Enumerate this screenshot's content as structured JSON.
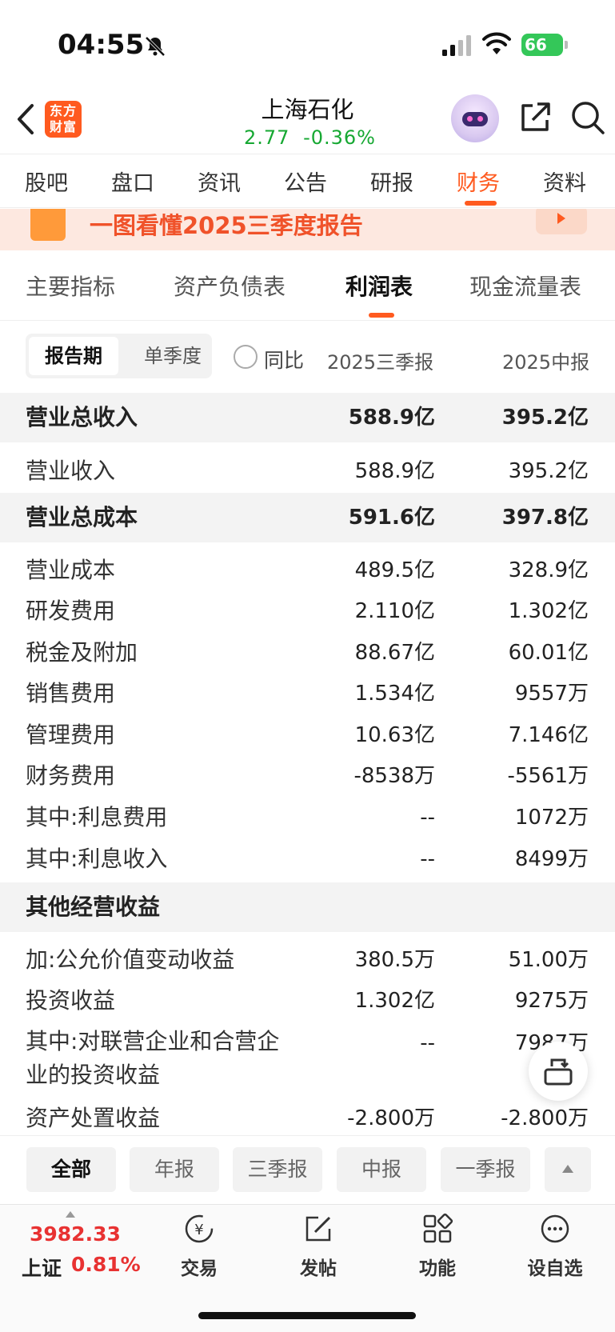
{
  "status": {
    "time": "04:55",
    "battery": "66"
  },
  "header": {
    "logo_text": "东方财富",
    "stock_name": "上海石化",
    "price": "2.77",
    "change": "-0.36%"
  },
  "top_tabs": [
    "股吧",
    "盘口",
    "资讯",
    "公告",
    "研报",
    "财务",
    "资料"
  ],
  "banner": {
    "text": "一图看懂2025三季度报告"
  },
  "sub_tabs": [
    "主要指标",
    "资产负债表",
    "利润表",
    "现金流量表"
  ],
  "filter": {
    "report_period": "报告期",
    "single_quarter": "单季度",
    "yoy": "同比",
    "col1": "2025三季报",
    "col2": "2025中报"
  },
  "rows": [
    {
      "label": "营业总收入",
      "v1": "588.9亿",
      "v2": "395.2亿",
      "section": true
    },
    {
      "label": "营业收入",
      "v1": "588.9亿",
      "v2": "395.2亿"
    },
    {
      "label": "营业总成本",
      "v1": "591.6亿",
      "v2": "397.8亿",
      "section": true
    },
    {
      "label": "营业成本",
      "v1": "489.5亿",
      "v2": "328.9亿"
    },
    {
      "label": "研发费用",
      "v1": "2.110亿",
      "v2": "1.302亿"
    },
    {
      "label": "税金及附加",
      "v1": "88.67亿",
      "v2": "60.01亿"
    },
    {
      "label": "销售费用",
      "v1": "1.534亿",
      "v2": "9557万"
    },
    {
      "label": "管理费用",
      "v1": "10.63亿",
      "v2": "7.146亿"
    },
    {
      "label": "财务费用",
      "v1": "-8538万",
      "v2": "-5561万"
    },
    {
      "label": "其中:利息费用",
      "v1": "--",
      "v2": "1072万"
    },
    {
      "label": "其中:利息收入",
      "v1": "--",
      "v2": "8499万"
    },
    {
      "label": "其他经营收益",
      "v1": "",
      "v2": "",
      "section": true
    },
    {
      "label": "加:公允价值变动收益",
      "v1": "380.5万",
      "v2": "51.00万"
    },
    {
      "label": "投资收益",
      "v1": "1.302亿",
      "v2": "9275万"
    },
    {
      "label": "其中:对联营企业和合营企业的投资收益",
      "v1": "--",
      "v2": "7987万"
    },
    {
      "label": "资产处置收益",
      "v1": "-2.800万",
      "v2": "-2.800万"
    }
  ],
  "periods": [
    "全部",
    "年报",
    "三季报",
    "中报",
    "一季报"
  ],
  "bottom": {
    "index_value": "3982.33",
    "index_name": "上证",
    "index_change": "0.81%",
    "nav": [
      "交易",
      "发帖",
      "功能",
      "设自选"
    ]
  }
}
